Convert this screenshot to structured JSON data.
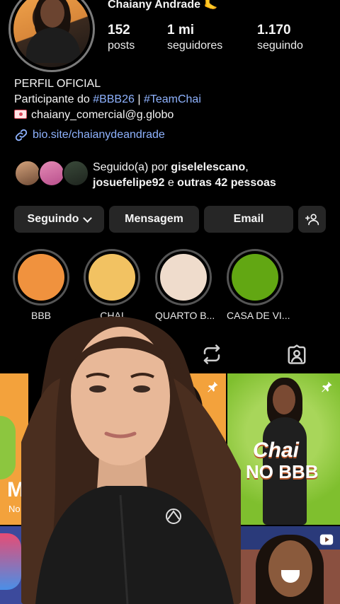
{
  "profile": {
    "username": "Chaiany Andrade 🦶",
    "stats": [
      {
        "value": "152",
        "label": "posts"
      },
      {
        "value": "1 mi",
        "label": "seguidores"
      },
      {
        "value": "1.170",
        "label": "seguindo"
      }
    ],
    "bio": {
      "line1": "PERFIL OFICIAL",
      "line2_prefix": "Participante do ",
      "hashtag1": "#BBB26",
      "separator": " | ",
      "hashtag2": "#TeamChai",
      "email": "chaiany_comercial@g.globo",
      "link": "bio.site/chaianydeandrade"
    },
    "followed_by": {
      "prefix": "Seguido(a) por ",
      "user1": "giselelescano",
      "comma": ",",
      "user2": "josuefelipe92",
      "middle": " e ",
      "others": "outras 42 pessoas"
    }
  },
  "actions": {
    "following": "Seguindo",
    "message": "Mensagem",
    "email": "Email"
  },
  "highlights": [
    {
      "label": "BBB",
      "color": "#f0923e"
    },
    {
      "label": "CHAI",
      "color": "#f2c262"
    },
    {
      "label": "QUARTO B...",
      "color": "#efdccc"
    },
    {
      "label": "CASA DE VI...",
      "color": "#62a713"
    }
  ],
  "posts": {
    "left_partial_title": "M",
    "left_partial_sub": "No",
    "right_title_1": "Chai",
    "right_title_2": "NO BBB"
  },
  "colors": {
    "link": "#8fb3ff",
    "button_bg": "#262626",
    "post_orange": "#f3a23c",
    "post_green": "#8cc63f"
  }
}
